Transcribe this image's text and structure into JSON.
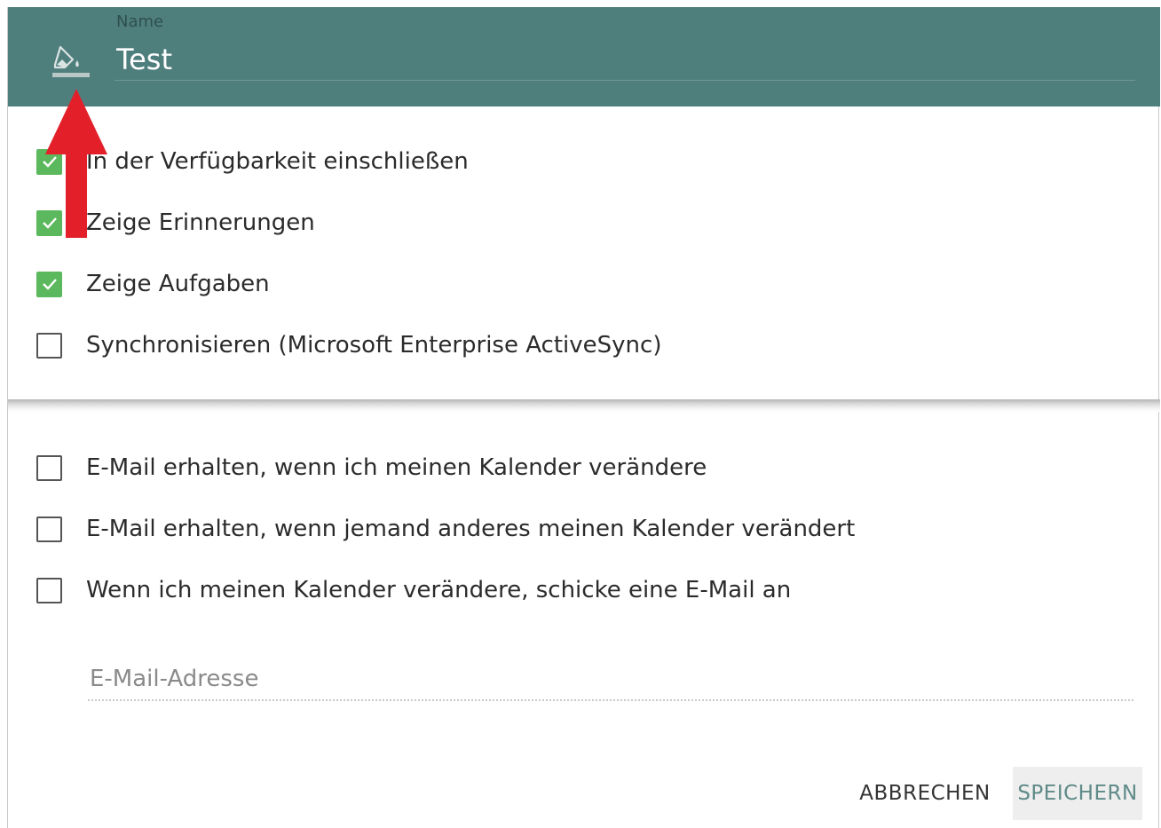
{
  "header": {
    "name_label": "Name",
    "name_value": "Test",
    "color_icon": "paint-bucket-icon",
    "background_color": "#4f7f7d"
  },
  "options": [
    {
      "label": "In der Verfügbarkeit einschließen",
      "checked": true
    },
    {
      "label": "Zeige Erinnerungen",
      "checked": true
    },
    {
      "label": "Zeige Aufgaben",
      "checked": true
    },
    {
      "label": "Synchronisieren (Microsoft Enterprise ActiveSync)",
      "checked": false
    }
  ],
  "notifications": [
    {
      "label": "E-Mail erhalten, wenn ich meinen Kalender verändere",
      "checked": false
    },
    {
      "label": "E-Mail erhalten, wenn jemand anderes meinen Kalender verändert",
      "checked": false
    },
    {
      "label": "Wenn ich meinen Kalender verändere, schicke eine E-Mail an",
      "checked": false
    }
  ],
  "email_field": {
    "placeholder": "E-Mail-Adresse",
    "value": ""
  },
  "buttons": {
    "cancel": "ABBRECHEN",
    "save": "SPEICHERN"
  },
  "colors": {
    "checked": "#5cb85c",
    "annotation_arrow": "#e3202a",
    "save_text": "#5e8a88"
  }
}
